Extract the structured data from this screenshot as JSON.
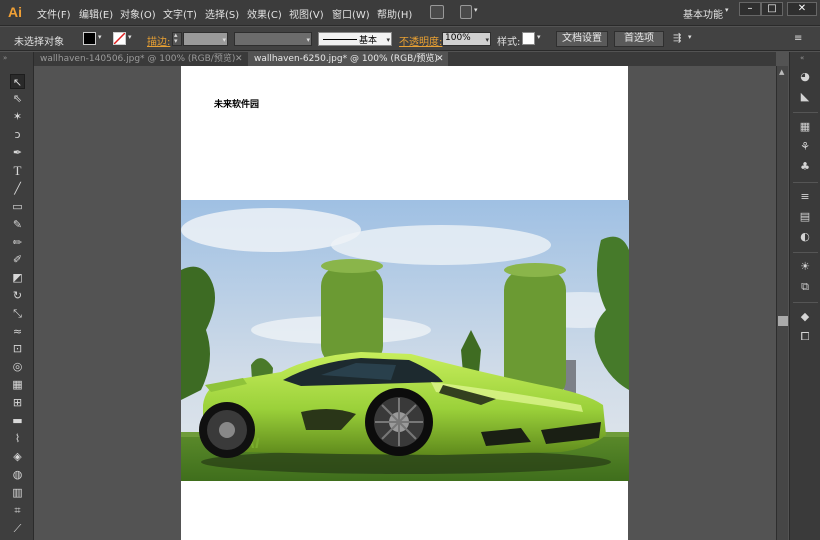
{
  "app": {
    "logo": "Ai",
    "workspace": "基本功能",
    "window_controls": [
      "–",
      "□",
      "✕"
    ]
  },
  "menu": [
    "文件(F)",
    "编辑(E)",
    "对象(O)",
    "文字(T)",
    "选择(S)",
    "效果(C)",
    "视图(V)",
    "窗口(W)",
    "帮助(H)"
  ],
  "control_bar": {
    "selection_label": "未选择对象",
    "stroke_label": "描边:",
    "stroke_style": "基本",
    "opacity_label": "不透明度:",
    "opacity_value": "100%",
    "style_label": "样式:",
    "doc_setup_button": "文档设置",
    "preferences_button": "首选项"
  },
  "tabs": [
    {
      "label": "wallhaven-140506.jpg* @ 100% (RGB/预览)",
      "active": false
    },
    {
      "label": "wallhaven-6250.jpg* @ 100% (RGB/预览)",
      "active": true
    }
  ],
  "artboard": {
    "text": "未来软件园"
  },
  "colors": {
    "accent_orange": "#e8a033",
    "car_green": "#9bd13a"
  }
}
